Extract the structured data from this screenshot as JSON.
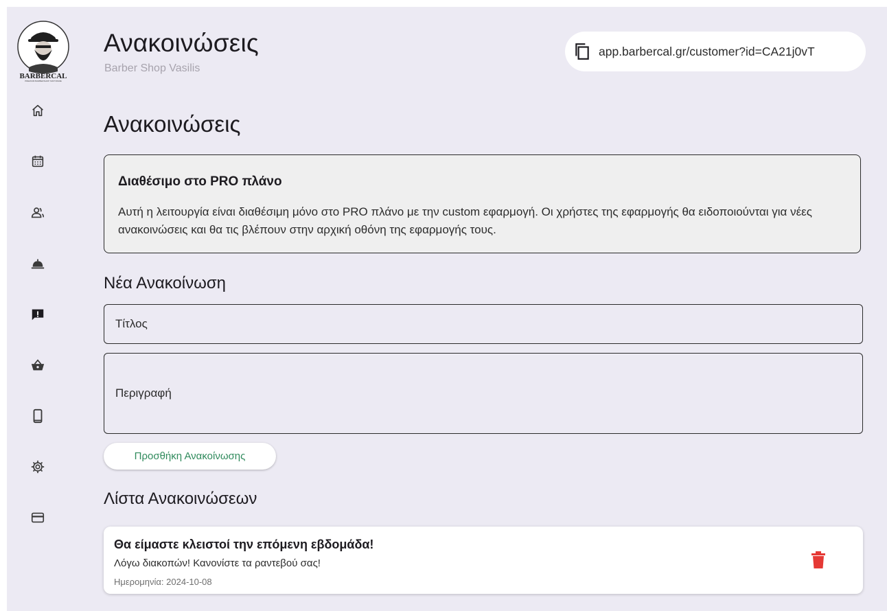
{
  "logo": {
    "text": "BARBERCAL",
    "tagline": "PREMIUM BARBERSHOP SOFTWARE"
  },
  "sidebar": {
    "items": [
      {
        "icon": "home-icon"
      },
      {
        "icon": "calendar-icon"
      },
      {
        "icon": "customers-icon"
      },
      {
        "icon": "services-icon"
      },
      {
        "icon": "announcements-icon"
      },
      {
        "icon": "shop-icon"
      },
      {
        "icon": "mobile-app-icon"
      },
      {
        "icon": "settings-icon"
      },
      {
        "icon": "billing-icon"
      }
    ]
  },
  "header": {
    "title": "Ανακοινώσεις",
    "subtitle": "Barber Shop Vasilis",
    "url": "app.barbercal.gr/customer?id=CA21j0vT"
  },
  "page": {
    "title": "Ανακοινώσεις"
  },
  "notice": {
    "title": "Διαθέσιμο στο PRO πλάνο",
    "text": "Αυτή η λειτουργία είναι διαθέσιμη μόνο στο PRO πλάνο με την custom εφαρμογή. Οι χρήστες της εφαρμογής θα ειδοποιούνται για νέες ανακοινώσεις και θα τις βλέπουν στην αρχική οθόνη της εφαρμογής τους."
  },
  "new_announcement": {
    "title": "Νέα Ανακοίνωση",
    "title_placeholder": "Τίτλος",
    "description_placeholder": "Περιγραφή",
    "add_button": "Προσθήκη Ανακοίνωσης"
  },
  "list": {
    "title": "Λίστα Ανακοινώσεων",
    "items": [
      {
        "title": "Θα είμαστε κλειστοί την επόμενη εβδομάδα!",
        "text": "Λόγω διακοπών! Κανονίστε τα ραντεβού σας!",
        "date": "Ημερομηνία: 2024-10-08"
      }
    ]
  },
  "colors": {
    "accent": "#2f8a5c",
    "delete": "#e53935",
    "background": "#eceaf3"
  }
}
